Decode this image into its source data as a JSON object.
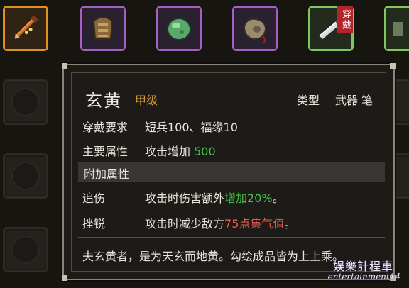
{
  "inventory": {
    "slots": [
      {
        "rarity": "orange",
        "icon": "weapon-brush-icon"
      },
      {
        "rarity": "purple",
        "icon": "armor-icon"
      },
      {
        "rarity": "purple",
        "icon": "jade-icon"
      },
      {
        "rarity": "purple",
        "icon": "pouch-icon"
      },
      {
        "rarity": "green",
        "icon": "blade-icon",
        "equipped_tag": "穿戴"
      },
      {
        "rarity": "green",
        "icon": "partial-item-icon"
      }
    ]
  },
  "tooltip": {
    "name": "玄黄",
    "grade": "甲级",
    "type_label": "类型",
    "type_value": "武器 笔",
    "requirement_label": "穿戴要求",
    "requirement_value": "短兵100、福缘10",
    "main_attr_label": "主要属性",
    "main_attr_text": "攻击增加",
    "main_attr_value": "500",
    "extra_section": "附加属性",
    "extra": [
      {
        "name": "追伤",
        "parts": [
          "攻击时伤害额外",
          "增加20%",
          "。"
        ]
      },
      {
        "name": "挫锐",
        "parts": [
          "攻击时减少敌方",
          "75点集气值",
          "。"
        ]
      }
    ],
    "description": "夫玄黄者，是为天玄而地黄。勾绘成品皆为上上乘。"
  },
  "watermark": {
    "line1": "娱樂計程車",
    "line2": "entertainment14"
  },
  "colors": {
    "accent_orange": "#e0901e",
    "accent_purple": "#a65fc4",
    "accent_green": "#7fc95a",
    "value_green": "#48c24a",
    "value_red": "#e45b4e",
    "grade_color": "#d4973a"
  }
}
